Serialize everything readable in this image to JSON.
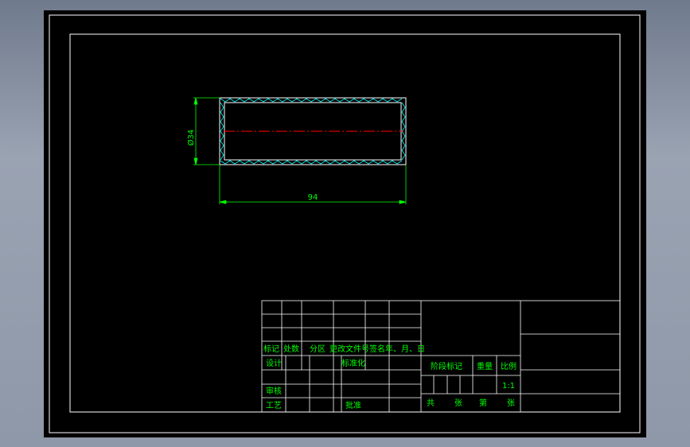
{
  "drawing": {
    "dimension_height": "Ø34",
    "dimension_width": "94"
  },
  "title_block": {
    "rev_headers": [
      "标记",
      "处数",
      "分区",
      "更改文件号",
      "签名",
      "年、月、日"
    ],
    "design": "设计",
    "standardization": "标准化",
    "review": "审核",
    "process": "工艺",
    "approve": "批准",
    "stage_mark": "阶段标记",
    "weight": "重量",
    "scale_label": "比例",
    "scale_value": "1:1",
    "total": "共",
    "sheets1": "张",
    "page": "第",
    "sheets2": "张"
  },
  "colors": {
    "background": "#000000",
    "frame": "#ffffff",
    "text": "#00ff00",
    "centerline": "#ff0000",
    "hatch": "#00ffff"
  }
}
